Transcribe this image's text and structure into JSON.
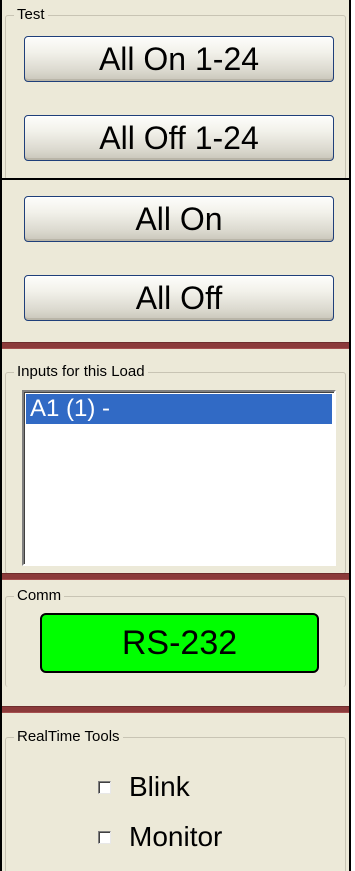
{
  "test": {
    "legend": "Test",
    "all_on_range_label": "All On 1-24",
    "all_off_range_label": "All Off 1-24",
    "all_on_label": "All On",
    "all_off_label": "All Off"
  },
  "inputs": {
    "legend": "Inputs for this Load",
    "items": [
      "A1 (1) -"
    ],
    "selected_index": 0
  },
  "comm": {
    "legend": "Comm",
    "status_label": "RS-232",
    "status_color": "#00ff00"
  },
  "realtime_tools": {
    "legend": "RealTime Tools",
    "blink_label": "Blink",
    "blink_checked": false,
    "monitor_label": "Monitor",
    "monitor_checked": false
  },
  "colors": {
    "panel_bg": "#ece9d8",
    "separator": "#8b3a3a",
    "selection": "#316ac5",
    "button_border": "#1f3f7a"
  }
}
